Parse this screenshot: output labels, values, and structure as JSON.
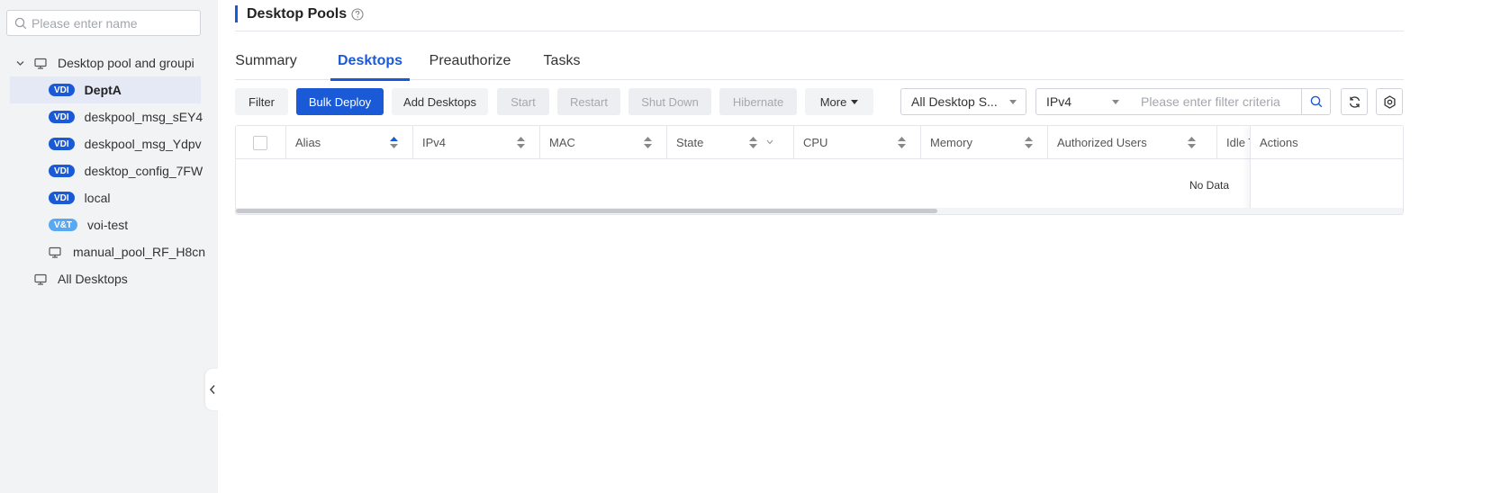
{
  "sidebar": {
    "search_placeholder": "Please enter name",
    "tree": {
      "root_label": "Desktop pool and groupi",
      "items": [
        {
          "badge": "VDI",
          "label": "DeptA",
          "selected": true
        },
        {
          "badge": "VDI",
          "label": "deskpool_msg_sEY4"
        },
        {
          "badge": "VDI",
          "label": "deskpool_msg_Ydpv"
        },
        {
          "badge": "VDI",
          "label": "desktop_config_7FW"
        },
        {
          "badge": "VDI",
          "label": "local"
        },
        {
          "badge": "V&T",
          "label": "voi-test"
        }
      ],
      "manual_pool_label": "manual_pool_RF_H8cn",
      "all_desktops_label": "All Desktops"
    }
  },
  "header": {
    "title": "Desktop Pools"
  },
  "tabs": [
    {
      "label": "Summary"
    },
    {
      "label": "Desktops",
      "active": true
    },
    {
      "label": "Preauthorize"
    },
    {
      "label": "Tasks"
    }
  ],
  "toolbar": {
    "filter": "Filter",
    "bulk_deploy": "Bulk Deploy",
    "add_desktops": "Add Desktops",
    "start": "Start",
    "restart": "Restart",
    "shut_down": "Shut Down",
    "hibernate": "Hibernate",
    "more": "More",
    "status_select": "All Desktop S...",
    "field_select": "IPv4",
    "filter_placeholder": "Please enter filter criteria"
  },
  "table": {
    "columns": [
      "Alias",
      "IPv4",
      "MAC",
      "State",
      "CPU",
      "Memory",
      "Authorized Users",
      "Idle T"
    ],
    "actions_column": "Actions",
    "empty_text": "No Data",
    "horizontal_scroll_fraction": 0.6
  },
  "colors": {
    "accent": "#1a5ad7",
    "badge_vt": "#58a9f4",
    "sidebar_bg": "#f2f3f5"
  }
}
